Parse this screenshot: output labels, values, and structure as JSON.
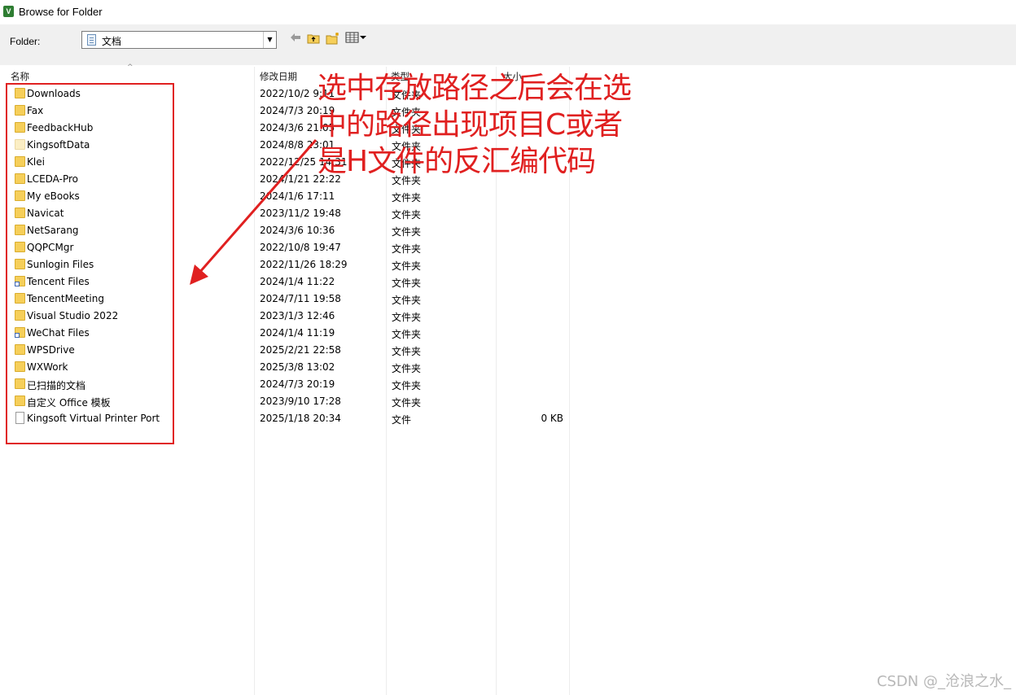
{
  "window": {
    "title": "Browse for Folder"
  },
  "toolbar": {
    "folder_label": "Folder:",
    "folder_value": "文档",
    "back_icon": "left-arrow-icon",
    "up_icon": "up-folder-icon",
    "new_folder_icon": "new-folder-icon",
    "view_icon": "view-menu-icon"
  },
  "columns": {
    "name": "名称",
    "date": "修改日期",
    "type": "类型",
    "size": "大小"
  },
  "files": [
    {
      "name": "Downloads",
      "date": "2022/10/2 9:11",
      "type": "文件夹",
      "size": "",
      "icon": "folder"
    },
    {
      "name": "Fax",
      "date": "2024/7/3 20:19",
      "type": "文件夹",
      "size": "",
      "icon": "folder"
    },
    {
      "name": "FeedbackHub",
      "date": "2024/3/6 21:05",
      "type": "文件夹",
      "size": "",
      "icon": "folder"
    },
    {
      "name": "KingsoftData",
      "date": "2024/8/8 23:01",
      "type": "文件夹",
      "size": "",
      "icon": "folder-pale"
    },
    {
      "name": "Klei",
      "date": "2022/12/25 14:31",
      "type": "文件夹",
      "size": "",
      "icon": "folder"
    },
    {
      "name": "LCEDA-Pro",
      "date": "2024/1/21 22:22",
      "type": "文件夹",
      "size": "",
      "icon": "folder"
    },
    {
      "name": "My eBooks",
      "date": "2024/1/6 17:11",
      "type": "文件夹",
      "size": "",
      "icon": "folder"
    },
    {
      "name": "Navicat",
      "date": "2023/11/2 19:48",
      "type": "文件夹",
      "size": "",
      "icon": "folder"
    },
    {
      "name": "NetSarang",
      "date": "2024/3/6 10:36",
      "type": "文件夹",
      "size": "",
      "icon": "folder"
    },
    {
      "name": "QQPCMgr",
      "date": "2022/10/8 19:47",
      "type": "文件夹",
      "size": "",
      "icon": "folder"
    },
    {
      "name": "Sunlogin Files",
      "date": "2022/11/26 18:29",
      "type": "文件夹",
      "size": "",
      "icon": "folder"
    },
    {
      "name": "Tencent Files",
      "date": "2024/1/4 11:22",
      "type": "文件夹",
      "size": "",
      "icon": "folder-shortcut"
    },
    {
      "name": "TencentMeeting",
      "date": "2024/7/11 19:58",
      "type": "文件夹",
      "size": "",
      "icon": "folder"
    },
    {
      "name": "Visual Studio 2022",
      "date": "2023/1/3 12:46",
      "type": "文件夹",
      "size": "",
      "icon": "folder"
    },
    {
      "name": "WeChat Files",
      "date": "2024/1/4 11:19",
      "type": "文件夹",
      "size": "",
      "icon": "folder-shortcut"
    },
    {
      "name": "WPSDrive",
      "date": "2025/2/21 22:58",
      "type": "文件夹",
      "size": "",
      "icon": "folder"
    },
    {
      "name": "WXWork",
      "date": "2025/3/8 13:02",
      "type": "文件夹",
      "size": "",
      "icon": "folder"
    },
    {
      "name": "已扫描的文档",
      "date": "2024/7/3 20:19",
      "type": "文件夹",
      "size": "",
      "icon": "folder"
    },
    {
      "name": "自定义 Office 模板",
      "date": "2023/9/10 17:28",
      "type": "文件夹",
      "size": "",
      "icon": "folder"
    },
    {
      "name": "Kingsoft Virtual Printer Port",
      "date": "2025/1/18 20:34",
      "type": "文件",
      "size": "0 KB",
      "icon": "file"
    }
  ],
  "annotation": {
    "text": "选中存放路径之后会在选中的路径出现项目C或者是H文件的反汇编代码",
    "color": "#e02020"
  },
  "watermark": "CSDN @_沧浪之水_"
}
